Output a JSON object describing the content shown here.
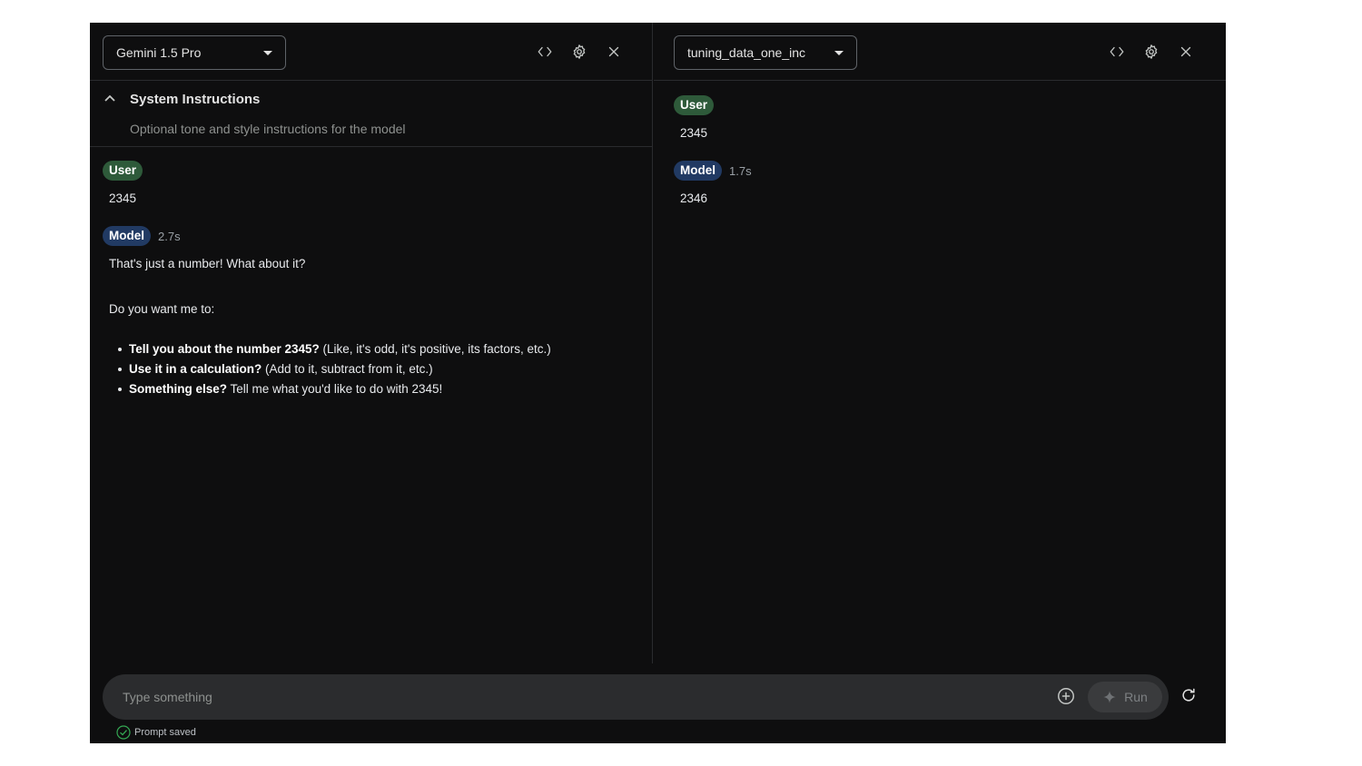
{
  "left_panel": {
    "model_name": "Gemini 1.5 Pro",
    "system_instructions": {
      "title": "System Instructions",
      "placeholder": "Optional tone and style instructions for the model"
    },
    "user_turn": {
      "role": "User",
      "text": "2345"
    },
    "model_turn": {
      "role": "Model",
      "timing": "2.7s",
      "intro": "That's just a number! What about it?",
      "question": "Do you want me to:",
      "bullets": [
        {
          "bold": "Tell you about the number 2345?",
          "rest": " (Like, it's odd, it's positive, its factors, etc.)"
        },
        {
          "bold": "Use it in a calculation?",
          "rest": " (Add to it, subtract from it, etc.)"
        },
        {
          "bold": "Something else?",
          "rest": " Tell me what you'd like to do with 2345!"
        }
      ]
    }
  },
  "right_panel": {
    "model_name": "tuning_data_one_inc",
    "user_turn": {
      "role": "User",
      "text": "2345"
    },
    "model_turn": {
      "role": "Model",
      "timing": "1.7s",
      "text": "2346"
    }
  },
  "composer": {
    "placeholder": "Type something",
    "run_label": "Run"
  },
  "status": {
    "text": "Prompt saved",
    "color": "#34a853"
  },
  "icons": {
    "code": "code-icon",
    "settings": "gear-icon",
    "close": "close-icon",
    "collapse": "chevron-up-icon",
    "add": "add-circle-icon",
    "run": "sparkle-icon",
    "refresh": "refresh-icon",
    "saved": "check-circle-icon"
  }
}
